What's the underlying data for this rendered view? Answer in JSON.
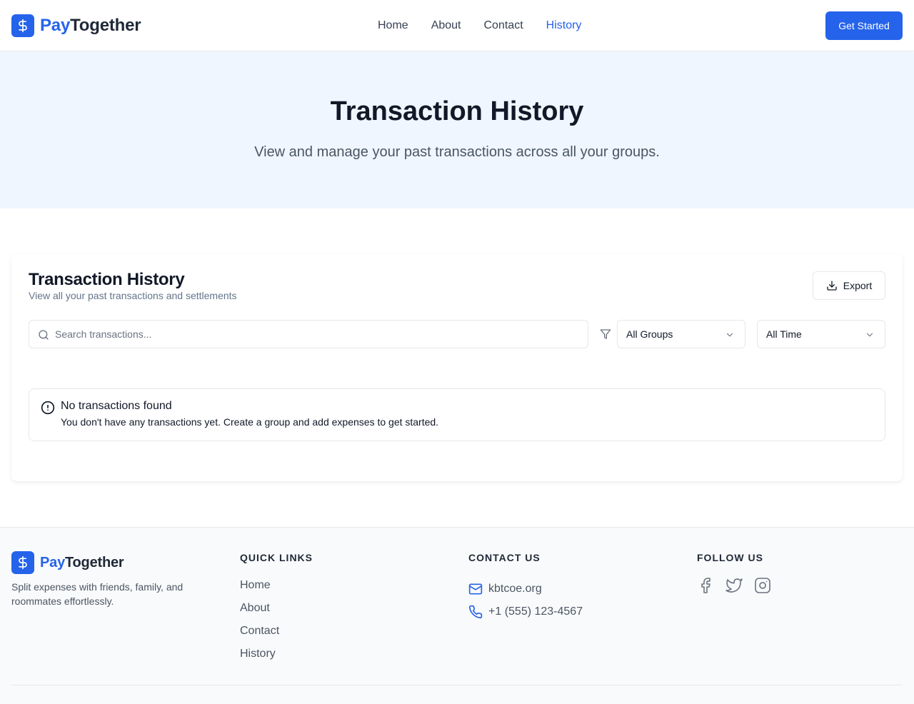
{
  "brand": {
    "part1": "Pay",
    "part2": "Together",
    "accent": "#2563eb"
  },
  "nav": {
    "items": [
      {
        "label": "Home",
        "active": false
      },
      {
        "label": "About",
        "active": false
      },
      {
        "label": "Contact",
        "active": false
      },
      {
        "label": "History",
        "active": true
      }
    ],
    "cta_label": "Get Started"
  },
  "hero": {
    "title": "Transaction History",
    "subtitle": "View and manage your past transactions across all your groups."
  },
  "history_card": {
    "title": "Transaction History",
    "subtitle": "View all your past transactions and settlements",
    "export_label": "Export",
    "search_placeholder": "Search transactions...",
    "group_filter": "All Groups",
    "time_filter": "All Time",
    "empty": {
      "title": "No transactions found",
      "description": "You don't have any transactions yet. Create a group and add expenses to get started."
    }
  },
  "footer": {
    "tagline": "Split expenses with friends, family, and roommates effortlessly.",
    "quick_links_heading": "QUICK LINKS",
    "quick_links": [
      "Home",
      "About",
      "Contact",
      "History"
    ],
    "contact_heading": "CONTACT US",
    "email": "kbtcoe.org",
    "phone": "+1 (555) 123-4567",
    "follow_heading": "FOLLOW US",
    "social_icons": [
      "facebook-icon",
      "twitter-icon",
      "instagram-icon"
    ]
  }
}
